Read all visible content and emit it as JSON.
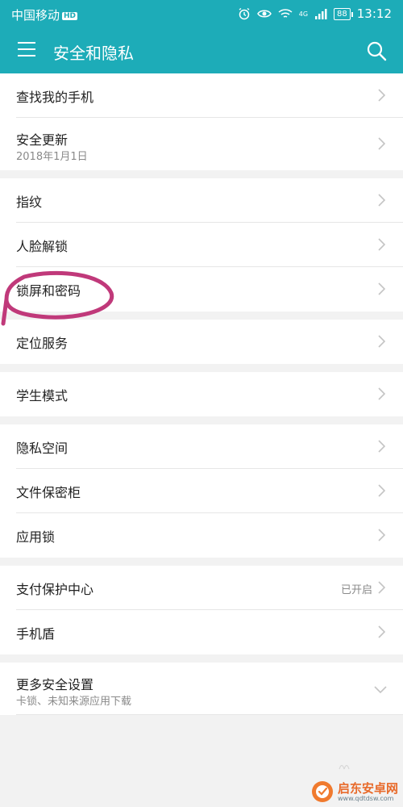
{
  "statusbar": {
    "carrier": "中国移动",
    "hd_badge": "HD",
    "network": "4G",
    "battery": "88",
    "time": "13:12"
  },
  "appbar": {
    "title": "安全和隐私"
  },
  "groups": [
    {
      "items": [
        {
          "label": "查找我的手机"
        },
        {
          "label": "安全更新",
          "sub": "2018年1月1日"
        }
      ]
    },
    {
      "items": [
        {
          "label": "指纹"
        },
        {
          "label": "人脸解锁"
        },
        {
          "label": "锁屏和密码"
        }
      ]
    },
    {
      "items": [
        {
          "label": "定位服务"
        }
      ]
    },
    {
      "items": [
        {
          "label": "学生模式"
        }
      ]
    },
    {
      "items": [
        {
          "label": "隐私空间"
        },
        {
          "label": "文件保密柜"
        },
        {
          "label": "应用锁"
        }
      ]
    },
    {
      "items": [
        {
          "label": "支付保护中心",
          "status": "已开启"
        },
        {
          "label": "手机盾"
        }
      ]
    },
    {
      "items": [
        {
          "label": "更多安全设置",
          "sub": "卡锁、未知来源应用下载"
        }
      ]
    }
  ],
  "watermark": {
    "name": "启东安卓网",
    "url": "www.qdtdsw.com"
  },
  "colors": {
    "primary": "#1dacb8",
    "annotation": "#c0397a",
    "chevron": "#c4c4c4"
  }
}
